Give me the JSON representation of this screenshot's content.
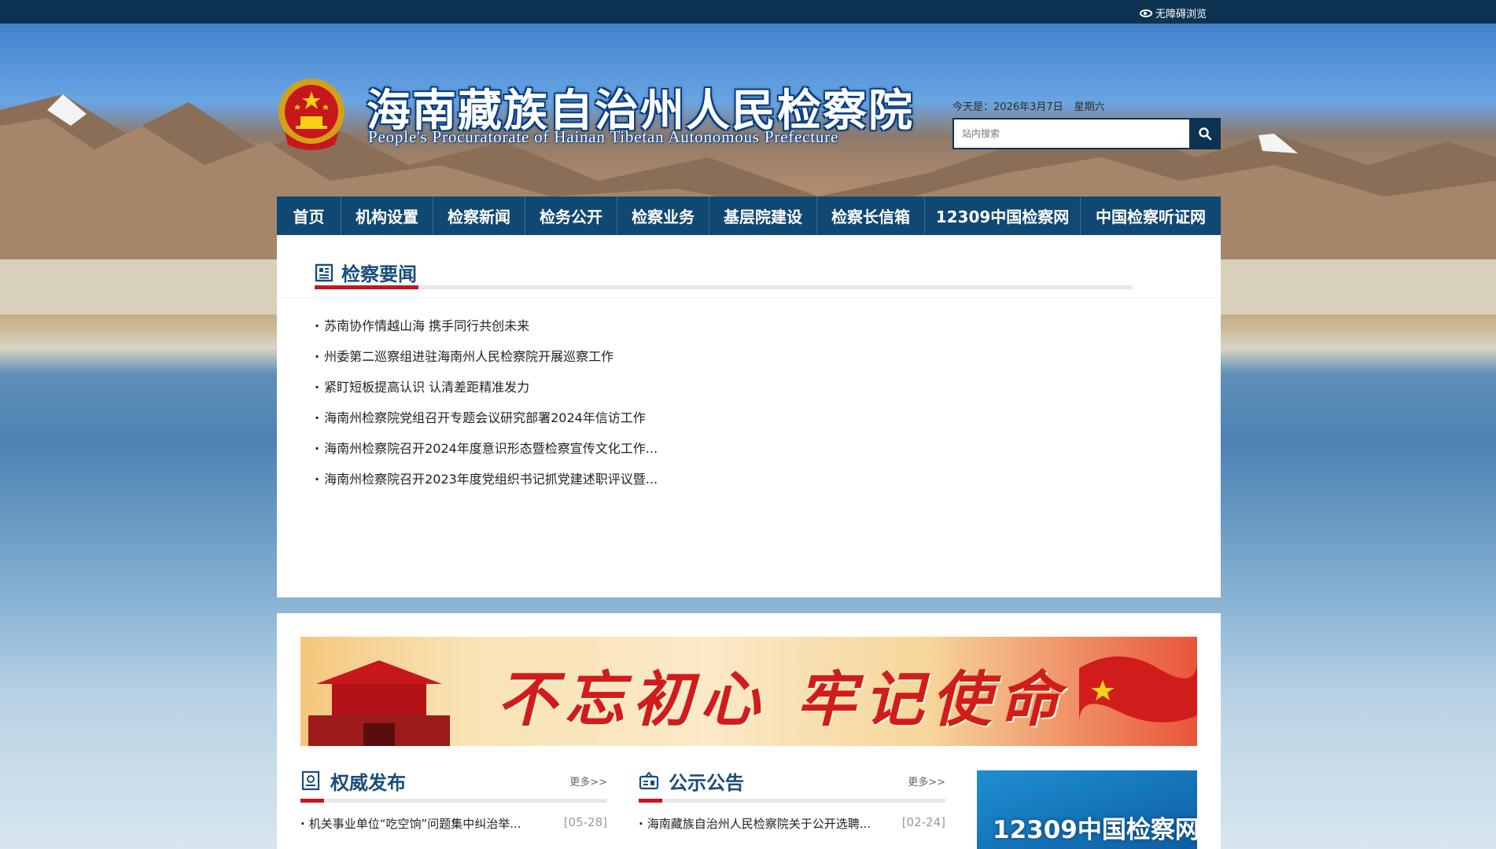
{
  "topbar": {
    "accessibility_label": "无障碍浏览"
  },
  "header": {
    "title": "海南藏族自治州人民检察院",
    "subtitle": "People's Procuratorate of Hainan Tibetan Autonomous Prefecture",
    "date_label": "今天是：2026年3月7日",
    "weekday": "星期六",
    "search_placeholder": "站内搜索"
  },
  "nav": {
    "items": [
      {
        "label": "首页"
      },
      {
        "label": "机构设置"
      },
      {
        "label": "检察新闻"
      },
      {
        "label": "检务公开"
      },
      {
        "label": "检察业务"
      },
      {
        "label": "基层院建设"
      },
      {
        "label": "检察长信箱"
      },
      {
        "label": "12309中国检察网"
      },
      {
        "label": "中国检察听证网"
      }
    ]
  },
  "news": {
    "title": "检察要闻",
    "items": [
      "苏南协作情越山海 携手同行共创未来",
      "州委第二巡察组进驻海南州人民检察院开展巡察工作",
      "紧盯短板提高认识 认清差距精准发力",
      "海南州检察院党组召开专题会议研究部署2024年信访工作",
      "海南州检察院召开2024年度意识形态暨检察宣传文化工作...",
      "海南州检察院召开2023年度党组织书记抓党建述职评议暨..."
    ]
  },
  "banner": {
    "slogan": "不忘初心 牢记使命"
  },
  "authority": {
    "title": "权威发布",
    "more": "更多>>",
    "items": [
      {
        "text": "机关事业单位“吃空饷”问题集中纠治举...",
        "date": "[05-28]"
      }
    ]
  },
  "notice": {
    "title": "公示公告",
    "more": "更多>>",
    "items": [
      {
        "text": "海南藏族自治州人民检察院关于公开选聘...",
        "date": "[02-24]"
      }
    ]
  },
  "promo": {
    "label": "12309中国检察网"
  }
}
